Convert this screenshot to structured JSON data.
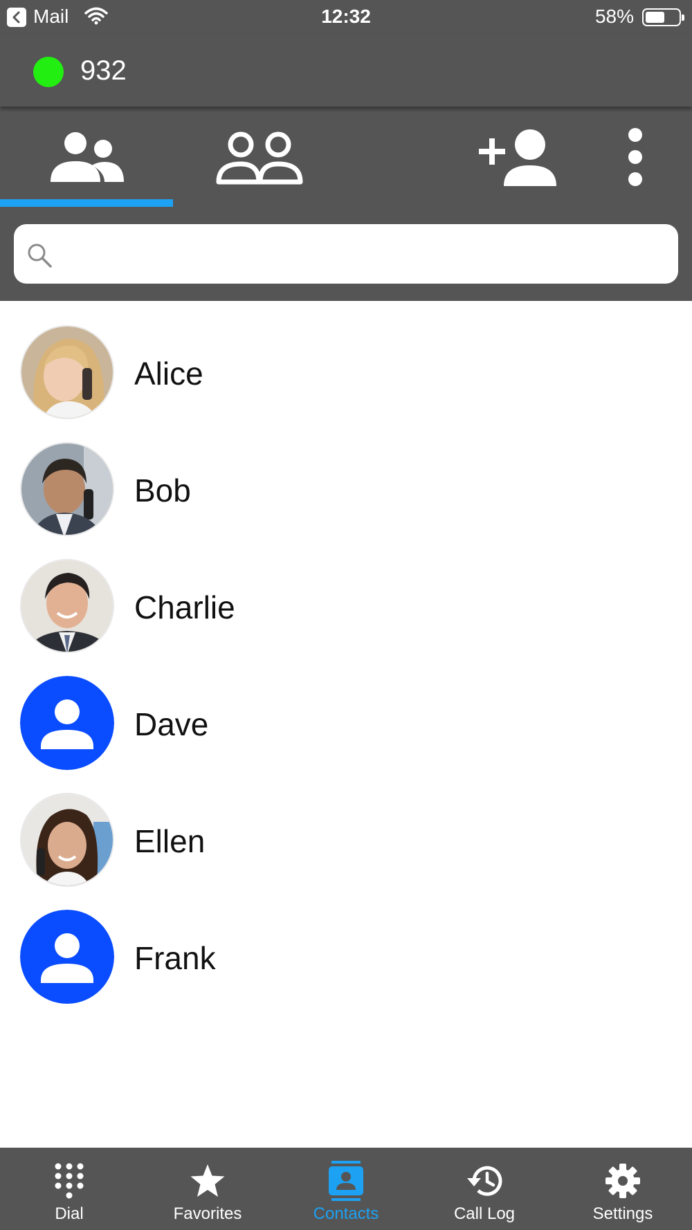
{
  "status_bar": {
    "back_app": "Mail",
    "time": "12:32",
    "battery_percent": "58%",
    "battery_level": 0.58,
    "icons": [
      "back-icon",
      "wifi-icon",
      "battery-icon"
    ]
  },
  "account": {
    "number": "932",
    "presence_color": "#22ee11"
  },
  "toolbar": {
    "tabs": [
      {
        "icon": "contacts-icon",
        "active": true
      },
      {
        "icon": "groups-icon",
        "active": false
      }
    ],
    "actions": [
      "add-contact-icon",
      "more-vert-icon"
    ],
    "indicator_color": "#1da1f2"
  },
  "search": {
    "placeholder": "",
    "value": ""
  },
  "contacts": [
    {
      "name": "Alice",
      "avatar": "photo"
    },
    {
      "name": "Bob",
      "avatar": "photo"
    },
    {
      "name": "Charlie",
      "avatar": "photo"
    },
    {
      "name": "Dave",
      "avatar": "default"
    },
    {
      "name": "Ellen",
      "avatar": "photo"
    },
    {
      "name": "Frank",
      "avatar": "default"
    }
  ],
  "bottom_nav": {
    "items": [
      {
        "label": "Dial",
        "icon": "dialpad-icon",
        "active": false
      },
      {
        "label": "Favorites",
        "icon": "star-icon",
        "active": false
      },
      {
        "label": "Contacts",
        "icon": "contacts-book-icon",
        "active": true
      },
      {
        "label": "Call Log",
        "icon": "history-icon",
        "active": false
      },
      {
        "label": "Settings",
        "icon": "gear-icon",
        "active": false
      }
    ],
    "active_color": "#1da1f2"
  },
  "colors": {
    "header_bg": "#555555",
    "default_avatar_bg": "#0a4cff"
  }
}
